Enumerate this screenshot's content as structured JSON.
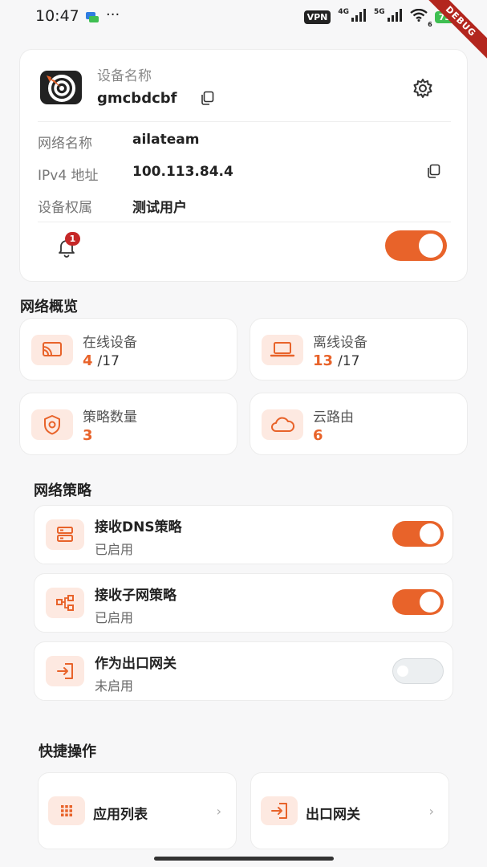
{
  "status_bar": {
    "time": "10:47",
    "dots": "···",
    "vpn": "VPN",
    "net1": "4G",
    "net2": "5G",
    "wifi_sub": "6",
    "battery": "73",
    "debug": "DEBUG"
  },
  "colors": {
    "accent": "#e8632a",
    "icon_bg": "#fde9e1",
    "badge": "#c62828"
  },
  "device": {
    "caption": "设备名称",
    "name": "gmcbdcbf",
    "rows": [
      {
        "label": "网络名称",
        "value": "ailateam"
      },
      {
        "label": "IPv4 地址",
        "value": "100.113.84.4"
      },
      {
        "label": "设备权属",
        "value": "测试用户"
      }
    ],
    "notification_count": "1",
    "connection_toggle": "on",
    "icons": [
      "app-logo",
      "copy-icon",
      "gear-icon",
      "bell-icon"
    ]
  },
  "overview": {
    "title": "网络概览",
    "stats": [
      {
        "label": "在线设备",
        "value": "4",
        "total": "/17",
        "icon": "cast-icon"
      },
      {
        "label": "离线设备",
        "value": "13",
        "total": "/17",
        "icon": "laptop-icon"
      },
      {
        "label": "策略数量",
        "value": "3",
        "total": "",
        "icon": "shield-icon"
      },
      {
        "label": "云路由",
        "value": "6",
        "total": "",
        "icon": "cloud-icon"
      }
    ]
  },
  "policies": {
    "title": "网络策略",
    "items": [
      {
        "title": "接收DNS策略",
        "status": "已启用",
        "enabled": true,
        "icon": "server-icon"
      },
      {
        "title": "接收子网策略",
        "status": "已启用",
        "enabled": true,
        "icon": "subnet-icon"
      },
      {
        "title": "作为出口网关",
        "status": "未启用",
        "enabled": false,
        "icon": "exit-gateway-icon"
      }
    ]
  },
  "quick_actions": {
    "title": "快捷操作",
    "items": [
      {
        "label": "应用列表",
        "icon": "grid-icon"
      },
      {
        "label": "出口网关",
        "icon": "exit-gateway-icon"
      }
    ],
    "chevron": "›"
  }
}
